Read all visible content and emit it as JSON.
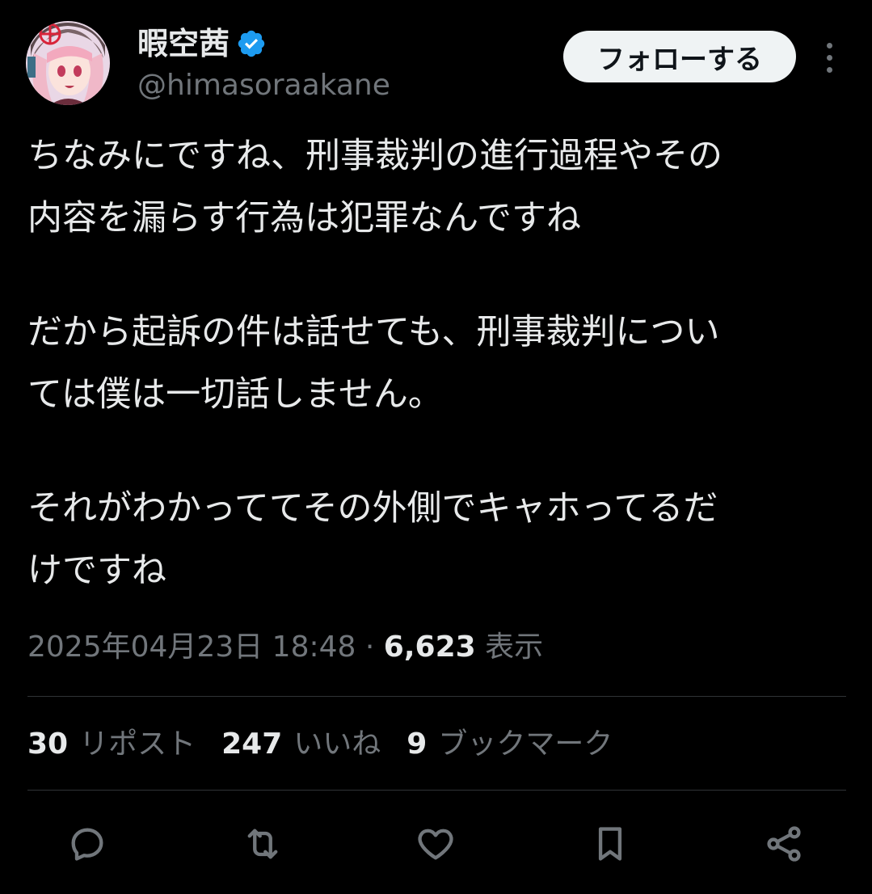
{
  "user": {
    "display_name": "暇空茜",
    "handle": "@himasoraakane",
    "verified_icon": "verified-badge-icon"
  },
  "follow_button": {
    "label": "フォローする"
  },
  "more_icon": "more-vertical-icon",
  "tweet": {
    "lines": [
      "ちなみにですね、刑事裁判の進行過程やその",
      "内容を漏らす行為は犯罪なんですね",
      "だから起訴の件は話せても、刑事裁判につい",
      "ては僕は一切話しません。",
      "それがわかっててその外側でキャホってるだ",
      "けですね"
    ]
  },
  "meta": {
    "timestamp": "2025年04月23日 18:48",
    "separator": "·",
    "views_count": "6,623",
    "views_label": "表示"
  },
  "stats": {
    "reposts_count": "30",
    "reposts_label": "リポスト",
    "likes_count": "247",
    "likes_label": "いいね",
    "bookmarks_count": "9",
    "bookmarks_label": "ブックマーク"
  },
  "actions": {
    "reply_icon": "reply-icon",
    "repost_icon": "repost-icon",
    "like_icon": "heart-icon",
    "bookmark_icon": "bookmark-icon",
    "share_icon": "share-icon"
  },
  "colors": {
    "background": "#000000",
    "text": "#e7e9ea",
    "secondary_text": "#71767b",
    "verified": "#1d9bf0",
    "divider": "#2f3336",
    "follow_button_bg": "#eff3f4"
  }
}
